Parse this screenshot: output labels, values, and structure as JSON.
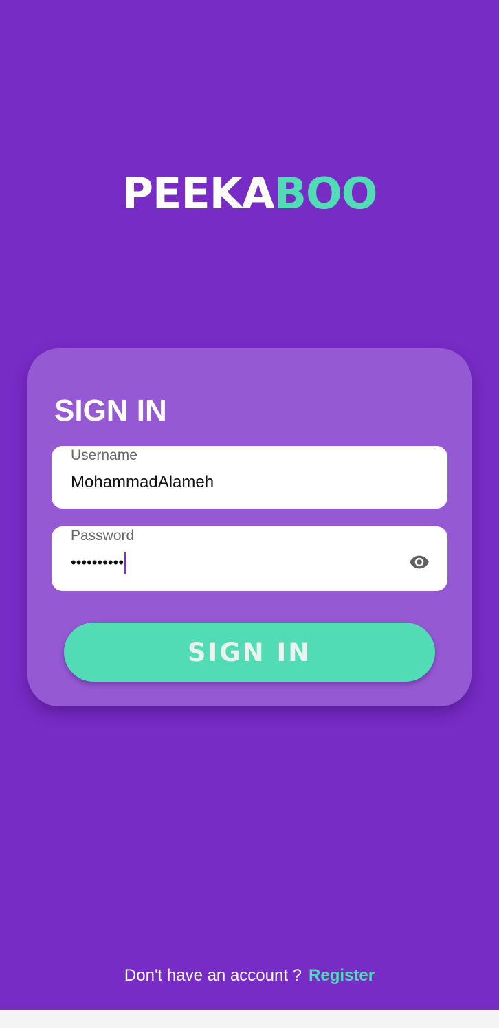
{
  "app": {
    "logo_part_a": "PEEKA",
    "logo_part_b": "BOO"
  },
  "colors": {
    "background": "#782cc6",
    "card": "#955ad3",
    "accent": "#52dcb6",
    "caret": "#7a2fd0"
  },
  "form": {
    "title": "SIGN IN",
    "username": {
      "label": "Username",
      "value": "MohammadAlameh"
    },
    "password": {
      "label": "Password",
      "masked_value": "••••••••••",
      "toggle_icon": "eye-icon"
    },
    "submit_label": "SIGN IN"
  },
  "footer": {
    "prompt": "Don't have an account ?",
    "register_label": "Register"
  }
}
